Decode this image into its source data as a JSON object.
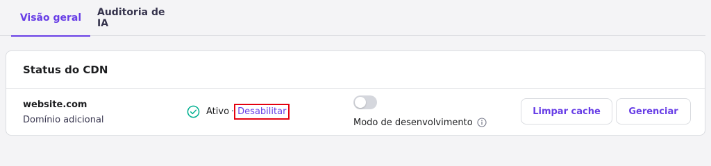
{
  "tabs": [
    {
      "label": "Visão geral",
      "active": true
    },
    {
      "label": "Auditoria de IA",
      "active": false
    }
  ],
  "cdn_card": {
    "title": "Status do CDN",
    "domain": {
      "name": "website.com",
      "type": "Domínio adicional"
    },
    "status": {
      "icon": "check-circle-icon",
      "label": "Ativo",
      "separator": "·",
      "action_label": "Desabilitar"
    },
    "dev_mode": {
      "label": "Modo de desenvolvimento",
      "enabled": false,
      "icon": "info-icon"
    },
    "buttons": {
      "clear_cache": "Limpar cache",
      "manage": "Gerenciar"
    }
  },
  "colors": {
    "accent": "#673de6",
    "success": "#00b090",
    "highlight": "#e4000f",
    "border": "#dadce0"
  }
}
